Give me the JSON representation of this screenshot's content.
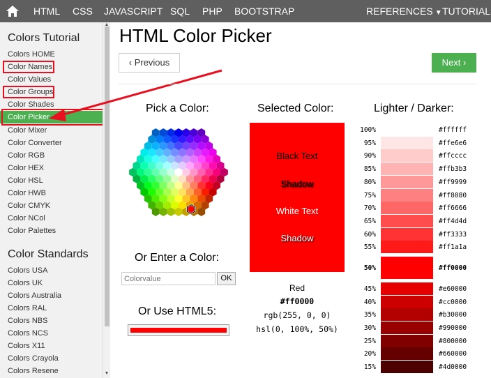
{
  "topnav": {
    "items": [
      "HTML",
      "CSS",
      "JAVASCRIPT",
      "SQL",
      "PHP",
      "BOOTSTRAP"
    ],
    "references": "REFERENCES",
    "tutorials": "TUTORIALS"
  },
  "sidebar": {
    "heading1": "Colors Tutorial",
    "tutorial_links": [
      "Colors HOME",
      "Color Names",
      "Color Values",
      "Color Groups",
      "Color Shades",
      "Color Picker",
      "Color Mixer",
      "Color Converter",
      "Color RGB",
      "Color HEX",
      "Color HSL",
      "Color HWB",
      "Color CMYK",
      "Color NCol",
      "Color Palettes"
    ],
    "active": "Color Picker",
    "heading2": "Color Standards",
    "standard_links": [
      "Colors USA",
      "Colors UK",
      "Colors Australia",
      "Colors RAL",
      "Colors NBS",
      "Colors NCS",
      "Colors X11",
      "Colors Crayola",
      "Colors Resene"
    ]
  },
  "main": {
    "title": "HTML Color Picker",
    "prev_label": "Previous",
    "next_label": "Next",
    "pick_label": "Pick a Color:",
    "selected_label": "Selected Color:",
    "lighter_label": "Lighter / Darker:",
    "enter_label": "Or Enter a Color:",
    "input_placeholder": "Colorvalue",
    "ok_label": "OK",
    "html5_label": "Or Use HTML5:",
    "html5_value": "#ff0000",
    "swatch_color": "#ff0000",
    "swatch_texts": [
      "Black Text",
      "Shadow",
      "White Text",
      "Shadow"
    ],
    "color_name": "Red",
    "color_hex": "#ff0000",
    "color_rgb": "rgb(255, 0, 0)",
    "color_hsl": "hsl(0, 100%, 50%)"
  },
  "shades": [
    {
      "pct": "100%",
      "hex": "#ffffff"
    },
    {
      "pct": "95%",
      "hex": "#ffe6e6"
    },
    {
      "pct": "90%",
      "hex": "#ffcccc"
    },
    {
      "pct": "85%",
      "hex": "#ffb3b3"
    },
    {
      "pct": "80%",
      "hex": "#ff9999"
    },
    {
      "pct": "75%",
      "hex": "#ff8080"
    },
    {
      "pct": "70%",
      "hex": "#ff6666"
    },
    {
      "pct": "65%",
      "hex": "#ff4d4d"
    },
    {
      "pct": "60%",
      "hex": "#ff3333"
    },
    {
      "pct": "55%",
      "hex": "#ff1a1a"
    },
    {
      "pct": "50%",
      "hex": "#ff0000"
    },
    {
      "pct": "45%",
      "hex": "#e60000"
    },
    {
      "pct": "40%",
      "hex": "#cc0000"
    },
    {
      "pct": "35%",
      "hex": "#b30000"
    },
    {
      "pct": "30%",
      "hex": "#990000"
    },
    {
      "pct": "25%",
      "hex": "#800000"
    },
    {
      "pct": "20%",
      "hex": "#660000"
    },
    {
      "pct": "15%",
      "hex": "#4d0000"
    }
  ],
  "colors": {
    "nav_bg": "#5f5f5f",
    "active_green": "#4caf50",
    "highlight_red": "#e8101f",
    "arrow_red": "#e8101f"
  }
}
